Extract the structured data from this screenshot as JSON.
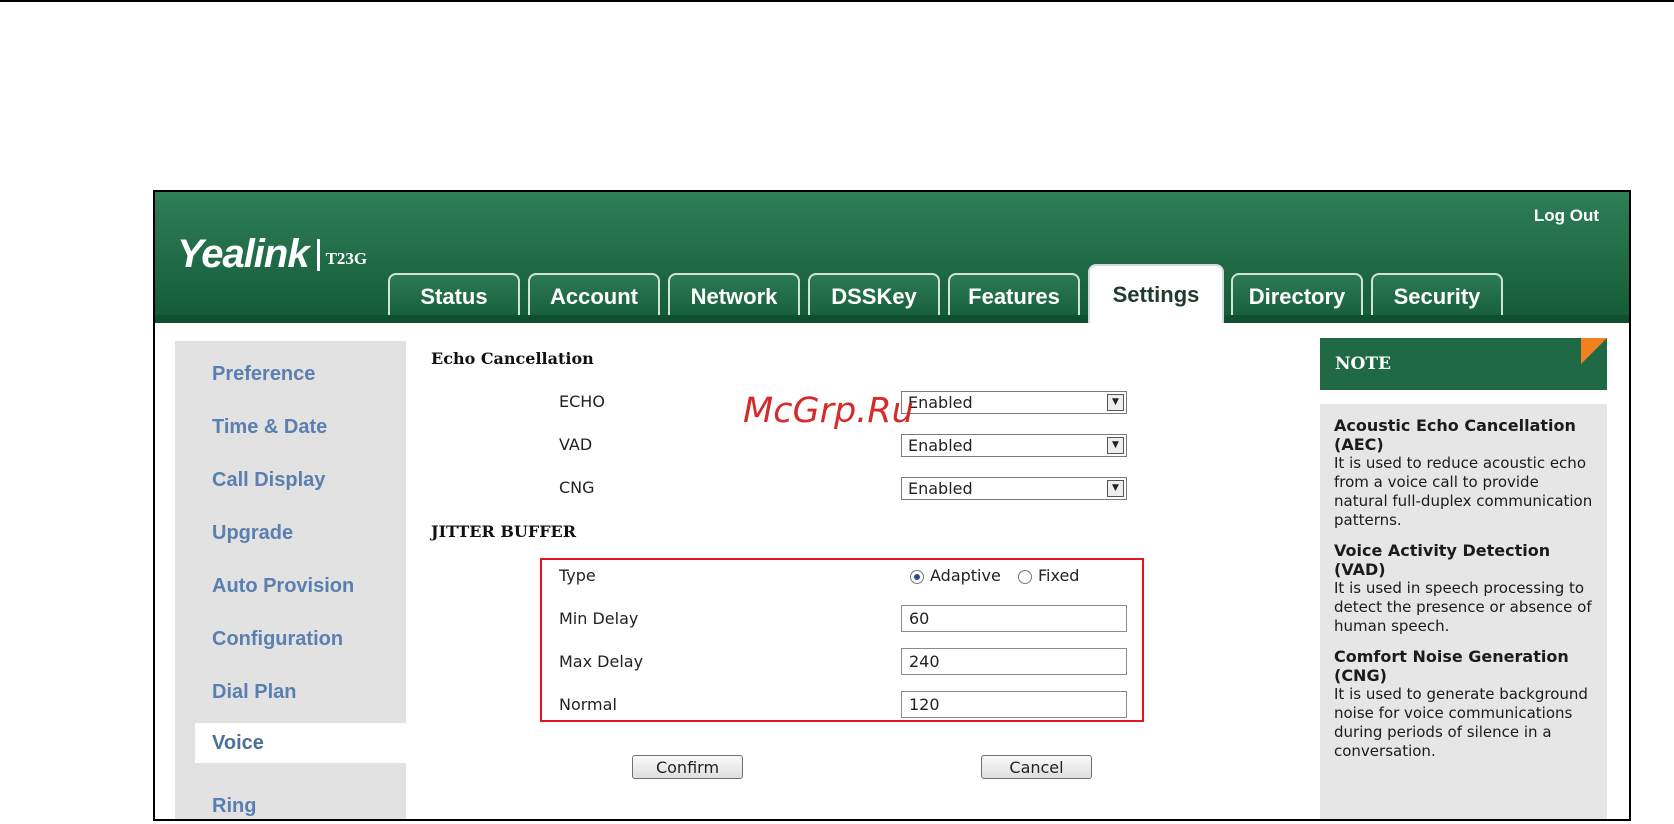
{
  "header": {
    "brand": "Yealink",
    "model": "T23G",
    "logout_label": "Log Out"
  },
  "tabs": [
    {
      "label": "Status"
    },
    {
      "label": "Account"
    },
    {
      "label": "Network"
    },
    {
      "label": "DSSKey"
    },
    {
      "label": "Features"
    },
    {
      "label": "Settings",
      "active": true
    },
    {
      "label": "Directory"
    },
    {
      "label": "Security"
    }
  ],
  "sidebar": {
    "items": [
      {
        "label": "Preference"
      },
      {
        "label": "Time & Date"
      },
      {
        "label": "Call Display"
      },
      {
        "label": "Upgrade"
      },
      {
        "label": "Auto Provision"
      },
      {
        "label": "Configuration"
      },
      {
        "label": "Dial Plan"
      },
      {
        "label": "Voice",
        "active": true
      },
      {
        "label": "Ring"
      }
    ]
  },
  "echo_section": {
    "title": "Echo Cancellation",
    "echo": {
      "label": "ECHO",
      "value": "Enabled"
    },
    "vad": {
      "label": "VAD",
      "value": "Enabled"
    },
    "cng": {
      "label": "CNG",
      "value": "Enabled"
    }
  },
  "jitter_section": {
    "title": "JITTER BUFFER",
    "type_label": "Type",
    "type_options": [
      "Adaptive",
      "Fixed"
    ],
    "type_selected": "Adaptive",
    "min_delay": {
      "label": "Min Delay",
      "value": "60"
    },
    "max_delay": {
      "label": "Max Delay",
      "value": "240"
    },
    "normal": {
      "label": "Normal",
      "value": "120"
    }
  },
  "actions": {
    "confirm_label": "Confirm",
    "cancel_label": "Cancel"
  },
  "note": {
    "title": "NOTE",
    "entries": [
      {
        "heading": "Acoustic Echo Cancellation (AEC)",
        "text": "It is used to reduce acoustic echo from a voice call to provide natural full-duplex communication patterns."
      },
      {
        "heading": "Voice Activity Detection (VAD)",
        "text": "It is used in speech processing to detect the presence or absence of human speech."
      },
      {
        "heading": "Comfort Noise Generation (CNG)",
        "text": "It is used to generate background noise for voice communications during periods of silence in a conversation."
      }
    ]
  },
  "watermark": "McGrp.Ru",
  "colors": {
    "header_green": "#1f6a45",
    "sidebar_text": "#5a7fb0",
    "highlight_red": "#e0161e",
    "note_corner": "#f4811f"
  }
}
